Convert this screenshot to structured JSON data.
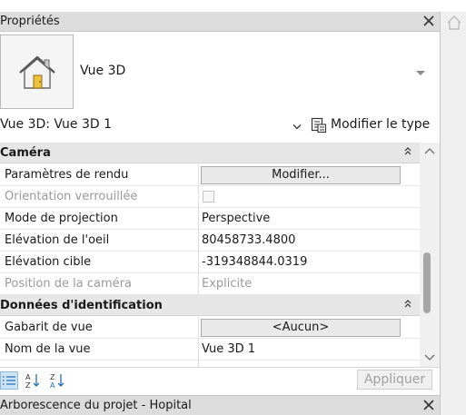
{
  "panel": {
    "title": "Propriétés",
    "close_icon": "close-icon"
  },
  "type_selector": {
    "family_icon": "house-icon",
    "type_name": "Vue 3D"
  },
  "instance": {
    "selected": "Vue 3D: Vue 3D 1",
    "edit_type_label": "Modifier le type"
  },
  "sections": [
    {
      "label": "Caméra",
      "rows": [
        {
          "name": "Paramètres de rendu",
          "value": "Modifier...",
          "kind": "button",
          "enabled": true
        },
        {
          "name": "Orientation verrouillée",
          "value": "",
          "kind": "checkbox",
          "checked": false,
          "enabled": false
        },
        {
          "name": "Mode de projection",
          "value": "Perspective",
          "kind": "text",
          "enabled": true
        },
        {
          "name": "Elévation de l'oeil",
          "value": "80458733.4800",
          "kind": "text",
          "enabled": true
        },
        {
          "name": "Elévation cible",
          "value": "-319348844.0319",
          "kind": "text",
          "enabled": true
        },
        {
          "name": "Position de la caméra",
          "value": "Explicite",
          "kind": "text",
          "enabled": false
        }
      ]
    },
    {
      "label": "Données d'identification",
      "rows": [
        {
          "name": "Gabarit de vue",
          "value": "<Aucun>",
          "kind": "button",
          "enabled": true
        },
        {
          "name": "Nom de la vue",
          "value": "Vue 3D 1",
          "kind": "text",
          "enabled": true
        }
      ]
    }
  ],
  "toolbar": {
    "categorized_icon": "list-categorized-icon",
    "sort_az_icon": "sort-az-icon",
    "sort_za_icon": "sort-za-icon",
    "apply_label": "Appliquer"
  },
  "project_browser": {
    "title": "Arborescence du projet - Hopital"
  },
  "colors": {
    "header_bg": "#dcdcdc",
    "section_bg": "#e6e6e6",
    "dim_text": "#9a9a9a",
    "active_tool": "#cde4f7"
  }
}
